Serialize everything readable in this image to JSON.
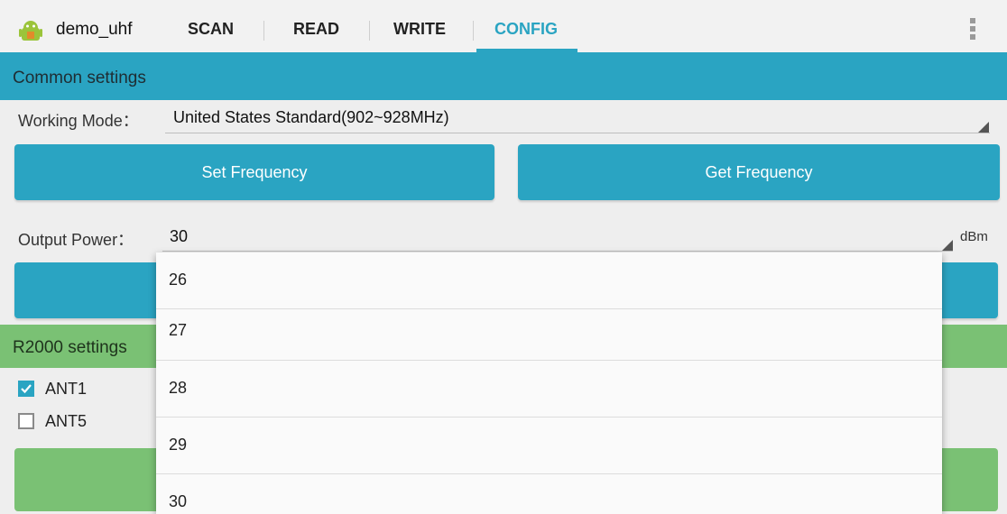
{
  "app": {
    "title": "demo_uhf",
    "icon": "android-icon"
  },
  "tabs": [
    {
      "label": "SCAN",
      "active": false
    },
    {
      "label": "READ",
      "active": false
    },
    {
      "label": "WRITE",
      "active": false
    },
    {
      "label": "CONFIG",
      "active": true
    }
  ],
  "colors": {
    "accent": "#2aa4c2",
    "green": "#7ac174",
    "tab_active_text": "#2aa4c2"
  },
  "common": {
    "header": "Common settings",
    "working_mode_label": "Working Mode：",
    "working_mode_value": "United States Standard(902~928MHz)",
    "set_frequency": "Set Frequency",
    "get_frequency": "Get Frequency",
    "output_power_label": "Output Power：",
    "output_power_value": "30",
    "output_power_unit": "dBm"
  },
  "r2000": {
    "header": "R2000 settings",
    "ant1": {
      "label": "ANT1",
      "checked": true
    },
    "ant5": {
      "label": "ANT5",
      "checked": false
    }
  },
  "dropdown": {
    "options": [
      "26",
      "27",
      "28",
      "29",
      "30"
    ]
  }
}
